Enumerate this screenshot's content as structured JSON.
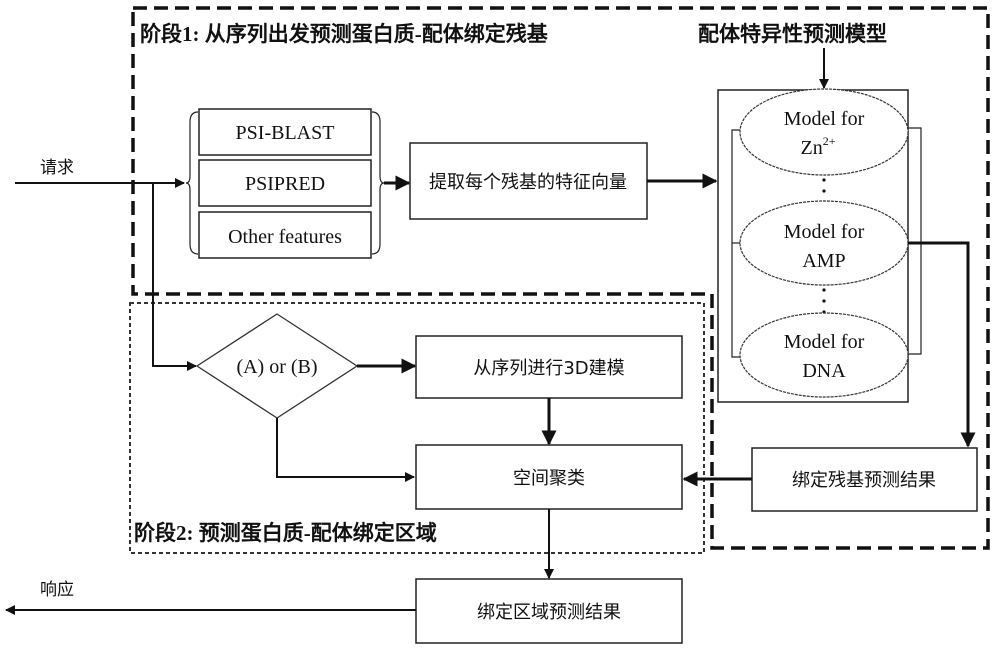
{
  "stage1": {
    "title": "阶段1: 从序列出发预测蛋白质-配体绑定残基",
    "models_title": "配体特异性预测模型"
  },
  "stage2": {
    "title": "阶段2: 预测蛋白质-配体绑定区域"
  },
  "io": {
    "request_label": "请求",
    "response_label": "响应"
  },
  "features": [
    {
      "label": "PSI-BLAST"
    },
    {
      "label": "PSIPRED"
    },
    {
      "label": "Other features"
    }
  ],
  "extract_box": "提取每个残基的特征向量",
  "models": [
    {
      "line1": "Model for",
      "line2": "Zn",
      "sup": "2+"
    },
    {
      "line1": "Model for",
      "line2": "AMP",
      "sup": ""
    },
    {
      "line1": "Model for",
      "line2": "DNA",
      "sup": ""
    }
  ],
  "decision": "(A) or (B)",
  "modeling_box": "从序列进行3D建模",
  "clustering_box": "空间聚类",
  "residue_result_box": "绑定残基预测结果",
  "region_result_box": "绑定区域预测结果",
  "colors": {
    "stroke": "#111111",
    "background": "#ffffff"
  }
}
